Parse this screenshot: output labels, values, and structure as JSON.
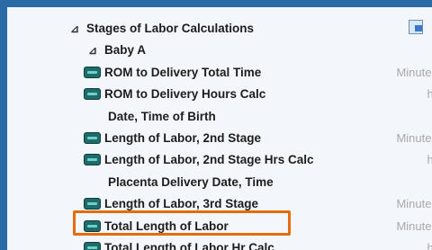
{
  "tree": {
    "group": {
      "expander": "⊿",
      "label": "Stages of Labor Calculations"
    },
    "subgroup": {
      "expander": "⊿",
      "label": "Baby A"
    },
    "items": [
      {
        "label": "ROM to Delivery Total Time",
        "unit": "Minutes",
        "has_icon": true
      },
      {
        "label": "ROM to Delivery Hours Calc",
        "unit": "hr",
        "has_icon": true
      },
      {
        "label": "Date, Time of Birth",
        "unit": "",
        "has_icon": false
      },
      {
        "label": "Length of Labor, 2nd Stage",
        "unit": "Minutes",
        "has_icon": true
      },
      {
        "label": "Length of Labor, 2nd Stage Hrs Calc",
        "unit": "hr",
        "has_icon": true
      },
      {
        "label": "Placenta Delivery Date, Time",
        "unit": "",
        "has_icon": false
      },
      {
        "label": "Length of Labor, 3rd Stage",
        "unit": "Minutes",
        "has_icon": true
      },
      {
        "label": "Total Length of Labor",
        "unit": "Minutes",
        "has_icon": true
      },
      {
        "label": "Total Length of Labor Hr Calc",
        "unit": "hr",
        "has_icon": true
      }
    ]
  },
  "highlight_color": "#e46c0a",
  "icon_color": "#1f6a6b"
}
